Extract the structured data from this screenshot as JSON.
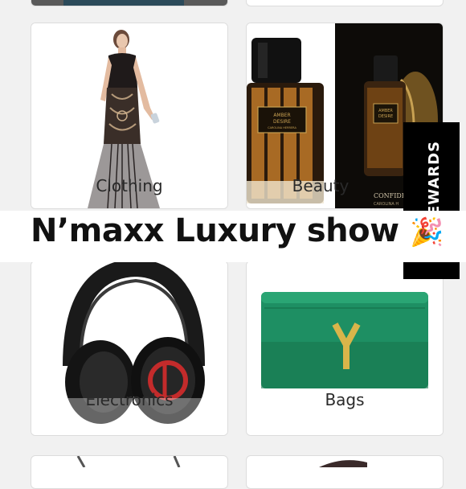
{
  "page": {
    "title": "N’maxx Luxury show",
    "title_emoji": "🎉"
  },
  "rewards_tab": {
    "label": "EWARDS"
  },
  "categories": [
    {
      "label": "Clothing",
      "image": "evening-gown-photo"
    },
    {
      "label": "Beauty",
      "image": "amber-desire-perfume-photo"
    },
    {
      "label": "Electronics",
      "image": "headphones-photo"
    },
    {
      "label": "Bags",
      "image": "green-clutch-photo"
    }
  ],
  "perfume": {
    "bottle_text_1": "AMBER",
    "bottle_text_2": "DESIRE",
    "bottle_sub": "CAROLINA HERRERA",
    "ad_text_1": "CONFIDE",
    "ad_text_2": "CAROLINA H"
  },
  "colors": {
    "bag_green": "#1e8f63",
    "clasp_gold": "#d9b54a",
    "headphone_red": "#c32b2b",
    "banner_black": "#000000"
  }
}
